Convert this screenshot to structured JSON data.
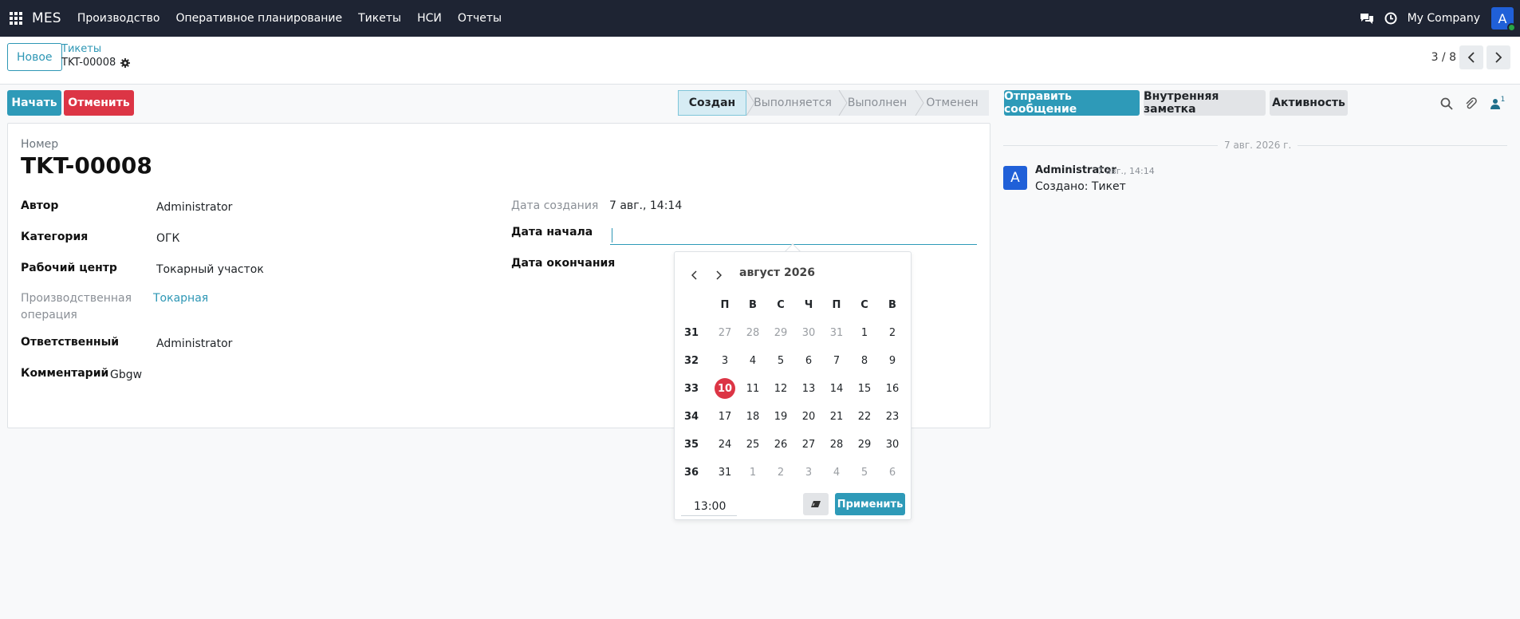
{
  "navbar": {
    "brand": "MES",
    "menu": [
      "Производство",
      "Оперативное планирование",
      "Тикеты",
      "НСИ",
      "Отчеты"
    ],
    "company": "My Company",
    "avatar_letter": "A"
  },
  "control": {
    "new_label": "Новое",
    "breadcrumb_parent": "Тикеты",
    "breadcrumb_current": "TKT-00008",
    "pager": "3 / 8"
  },
  "actions": {
    "start": "Начать",
    "cancel": "Отменить"
  },
  "statusbar": {
    "stages": [
      "Создан",
      "Выполняется",
      "Выполнен",
      "Отменен"
    ],
    "active": "Создан"
  },
  "chatter_buttons": {
    "send": "Отправить сообщение",
    "note": "Внутренняя заметка",
    "activity": "Активность",
    "followers_count": "1"
  },
  "form": {
    "number_label": "Номер",
    "number": "TKT-00008",
    "author_label": "Автор",
    "author": "Administrator",
    "category_label": "Категория",
    "category": "ОГК",
    "workcenter_label": "Рабочий центр",
    "workcenter": "Токарный участок",
    "operation_label_1": "Производственная",
    "operation_label_2": "операция",
    "operation": "Токарная",
    "responsible_label": "Ответственный",
    "responsible": "Administrator",
    "comment_label": "Комментарий",
    "comment": "Gbgw",
    "created_label": "Дата создания",
    "created": "7 авг., 14:14",
    "start_label": "Дата начала",
    "start": "",
    "end_label": "Дата окончания"
  },
  "datepicker": {
    "month": "август 2026",
    "weekdays": [
      "П",
      "В",
      "С",
      "Ч",
      "П",
      "С",
      "В"
    ],
    "weeks": [
      {
        "num": "31",
        "days": [
          [
            "27",
            0
          ],
          [
            "28",
            0
          ],
          [
            "29",
            0
          ],
          [
            "30",
            0
          ],
          [
            "31",
            0
          ],
          [
            "1",
            1
          ],
          [
            "2",
            1
          ]
        ]
      },
      {
        "num": "32",
        "days": [
          [
            "3",
            1
          ],
          [
            "4",
            1
          ],
          [
            "5",
            1
          ],
          [
            "6",
            1
          ],
          [
            "7",
            1
          ],
          [
            "8",
            1
          ],
          [
            "9",
            1
          ]
        ]
      },
      {
        "num": "33",
        "days": [
          [
            "10",
            2
          ],
          [
            "11",
            1
          ],
          [
            "12",
            1
          ],
          [
            "13",
            1
          ],
          [
            "14",
            1
          ],
          [
            "15",
            1
          ],
          [
            "16",
            1
          ]
        ]
      },
      {
        "num": "34",
        "days": [
          [
            "17",
            1
          ],
          [
            "18",
            1
          ],
          [
            "19",
            1
          ],
          [
            "20",
            1
          ],
          [
            "21",
            1
          ],
          [
            "22",
            1
          ],
          [
            "23",
            1
          ]
        ]
      },
      {
        "num": "35",
        "days": [
          [
            "24",
            1
          ],
          [
            "25",
            1
          ],
          [
            "26",
            1
          ],
          [
            "27",
            1
          ],
          [
            "28",
            1
          ],
          [
            "29",
            1
          ],
          [
            "30",
            1
          ]
        ]
      },
      {
        "num": "36",
        "days": [
          [
            "31",
            1
          ],
          [
            "1",
            0
          ],
          [
            "2",
            0
          ],
          [
            "3",
            0
          ],
          [
            "4",
            0
          ],
          [
            "5",
            0
          ],
          [
            "6",
            0
          ]
        ]
      }
    ],
    "time": "13:00",
    "apply": "Применить"
  },
  "chatter": {
    "date": "7 авг. 2026 г.",
    "author": "Administrator",
    "time": "7 авг., 14:14",
    "message": "Создано: Тикет",
    "avatar_letter": "A"
  },
  "colors": {
    "navbar": "#1e2433",
    "primary": "#2e9ab8",
    "danger": "#dc3545",
    "avatar": "#2060d8"
  }
}
